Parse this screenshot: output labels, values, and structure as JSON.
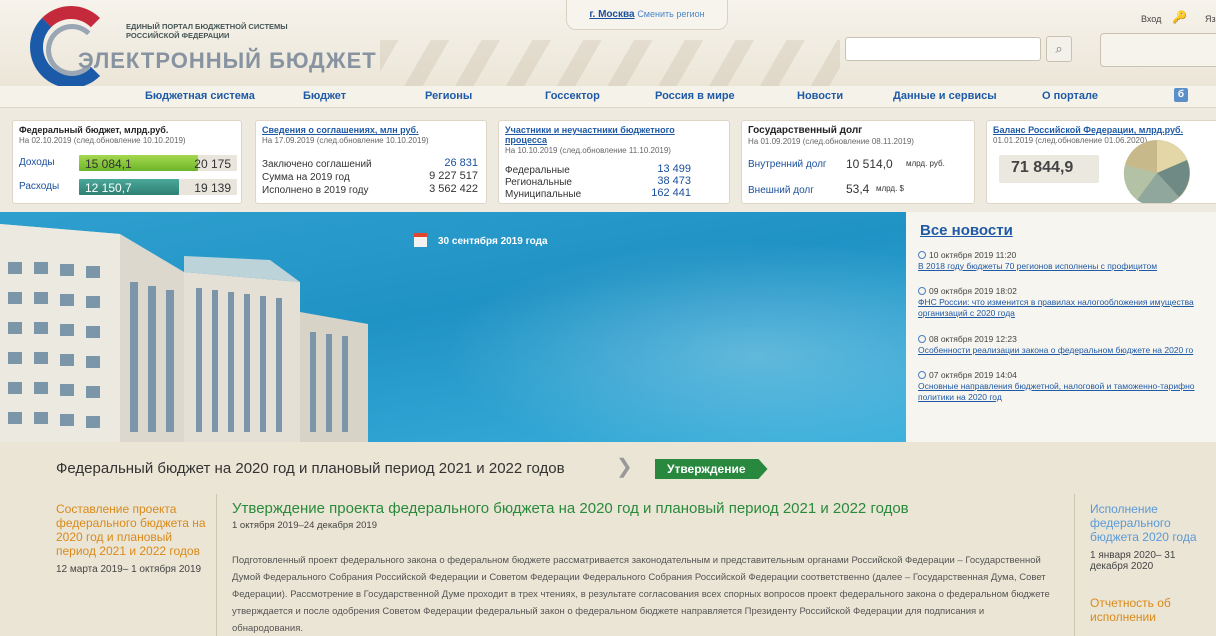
{
  "header": {
    "portal_title": "ЕДИНЫЙ ПОРТАЛ БЮДЖЕТНОЙ СИСТЕМЫ РОССИЙСКОЙ ФЕДЕРАЦИИ",
    "brand": "ЭЛЕКТРОННЫЙ БЮДЖЕТ",
    "region": "г. Москва",
    "change_region": "Сменить регион",
    "login": "Вход",
    "lang": "Яз"
  },
  "nav": {
    "items": [
      "Бюджетная система",
      "Бюджет",
      "Регионы",
      "Госсектор",
      "Россия в мире",
      "Новости",
      "Данные и сервисы",
      "О портале"
    ],
    "special": "б"
  },
  "stats": {
    "federal": {
      "title": "Федеральный бюджет, млрд.руб.",
      "sub": "На 02.10.2019 (след.обновление 10.10.2019)",
      "income_label": "Доходы",
      "income_value": "15 084,1",
      "income_total": "20 175",
      "income_fill": 0.75,
      "expense_label": "Расходы",
      "expense_value": "12 150,7",
      "expense_total": "19 139",
      "expense_fill": 0.63
    },
    "agreements": {
      "title": "Сведения о соглашениях, млн руб.",
      "sub": "На 17.09.2019 (след.обновление 10.10.2019)",
      "rows": [
        {
          "label": "Заключено соглашений",
          "value": "26 831"
        },
        {
          "label": "Сумма на 2019 год",
          "value": "9 227 517"
        },
        {
          "label": "Исполнено в 2019 году",
          "value": "3 562 422"
        }
      ]
    },
    "participants": {
      "title": "Участники и неучастники бюджетного процесса",
      "sub": "На 10.10.2019 (след.обновление 11.10.2019)",
      "rows": [
        {
          "label": "Федеральные",
          "value": "13 499"
        },
        {
          "label": "Региональные",
          "value": "38 473"
        },
        {
          "label": "Муниципальные",
          "value": "162 441"
        }
      ]
    },
    "debt": {
      "title": "Государственный долг",
      "sub": "На 01.09.2019 (след.обновление 08.11.2019)",
      "internal_label": "Внутренний долг",
      "internal_value": "10 514,0",
      "internal_unit": "млрд. руб.",
      "external_label": "Внешний долг",
      "external_value": "53,4",
      "external_unit": "млрд. $"
    },
    "balance": {
      "title": "Баланс Российской Федерации, млрд.руб.",
      "sub": "01.01.2019 (след.обновление 01.06.2020)",
      "value": "71 844,9"
    }
  },
  "banner": {
    "date": "30 сентября 2019 года"
  },
  "news": {
    "heading": "Все новости",
    "items": [
      {
        "date": "10 октября 2019 11:20",
        "text": [
          "В 2018 году бюджеты 70 регионов исполнены с профицитом"
        ]
      },
      {
        "date": "09 октября 2019 18:02",
        "text": [
          "ФНС России: что изменится в правилах налогообложения имущества",
          "организаций с 2020 года"
        ]
      },
      {
        "date": "08 октября 2019 12:23",
        "text": [
          "Особенности реализации закона о федеральном бюджете на 2020 го"
        ]
      },
      {
        "date": "07 октября 2019 14:04",
        "text": [
          "Основные направления бюджетной, налоговой и таможенно-тарифно",
          "политики на 2020 год"
        ]
      }
    ]
  },
  "lower": {
    "stage_title": "Федеральный бюджет на 2020 год и плановый период 2021 и 2022 годов",
    "stage_badge": "Утверждение",
    "left_title": "Составление проекта федерального бюджета на 2020 год и плановый период 2021 и 2022 годов",
    "left_dates": "12 марта 2019– 1 октября 2019",
    "main_title": "Утверждение проекта федерального бюджета на 2020 год и плановый период 2021 и 2022 годов",
    "main_dates": "1 октября 2019–24 декабря 2019",
    "main_text": "Подготовленный проект федерального закона о федеральном бюджете рассматривается законодательным и представительным органами Российской Федерации – Государственной Думой Федерального Собрания Российской Федерации и Советом Федерации Федерального Собрания Российской Федерации соответственно (далее – Государственная Дума, Совет Федерации). Рассмотрение в Государственной Думе проходит в трех чтениях, в результате согласования всех спорных вопросов проект федерального закона о федеральном бюджете утверждается и после одобрения Советом Федерации федеральный закон о федеральном бюджете направляется Президенту Российской Федерации для подписания и обнародования.",
    "right_title": "Исполнение федерального бюджета 2020 года",
    "right_dates": "1 января 2020– 31 декабря 2020",
    "right_title2": "Отчетность об исполнении"
  },
  "colors": {
    "accent": "#1f5aa6",
    "green": "#28883e",
    "orange": "#d98a1a"
  }
}
